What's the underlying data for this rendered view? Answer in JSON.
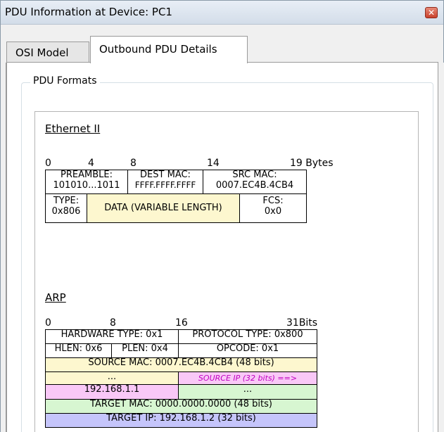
{
  "window": {
    "title": "PDU Information at Device: PC1",
    "close_symbol": "✕"
  },
  "tabs": [
    {
      "label": "OSI Model",
      "active": false
    },
    {
      "label": "Outbound PDU Details",
      "active": true
    }
  ],
  "group": {
    "label": "PDU Formats"
  },
  "ethernet": {
    "title": "Ethernet II",
    "ruler": {
      "t0": "0",
      "t4": "4",
      "t8": "8",
      "t14": "14",
      "t19": "19 Bytes"
    },
    "preamble_label": "PREAMBLE:",
    "preamble_value": "101010...1011",
    "dest_label": "DEST MAC:",
    "dest_value": "FFFF.FFFF.FFFF",
    "src_label": "SRC MAC:",
    "src_value": "0007.EC4B.4CB4",
    "type_label": "TYPE:",
    "type_value": "0x806",
    "data_label": "DATA (VARIABLE LENGTH)",
    "fcs_label": "FCS:",
    "fcs_value": "0x0"
  },
  "arp": {
    "title": "ARP",
    "ruler": {
      "t0": "0",
      "t8": "8",
      "t16": "16",
      "t31": "31Bits"
    },
    "hw_type": "HARDWARE TYPE: 0x1",
    "proto_type": "PROTOCOL TYPE: 0x800",
    "hlen": "HLEN: 0x6",
    "plen": "PLEN: 0x4",
    "opcode": "OPCODE: 0x1",
    "source_mac": "SOURCE MAC: 0007.EC4B.4CB4 (48 bits)",
    "ellipsis_left": "...",
    "source_ip_hint": "SOURCE IP (32 bits) ==>",
    "source_ip": "192.168.1.1",
    "ellipsis_right": "...",
    "target_mac": "TARGET MAC: 0000.0000.0000 (48 bits)",
    "target_ip": "TARGET IP: 192.168.1.2 (32 bits)"
  }
}
